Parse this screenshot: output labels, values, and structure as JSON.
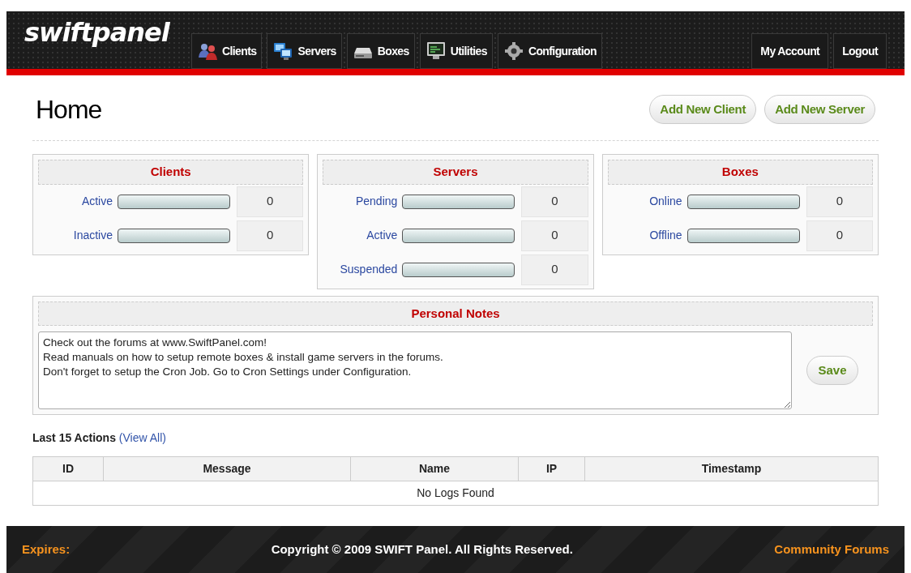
{
  "header": {
    "logo": "swiftpanel",
    "nav": [
      {
        "label": "Clients",
        "selected": false
      },
      {
        "label": "Servers",
        "selected": false
      },
      {
        "label": "Boxes",
        "selected": false
      },
      {
        "label": "Utilities",
        "selected": false
      },
      {
        "label": "Configuration",
        "selected": false
      }
    ],
    "account_nav": [
      "My Account",
      "Logout"
    ]
  },
  "page": {
    "title": "Home",
    "actions": [
      "Add New Client",
      "Add New Server"
    ]
  },
  "stats": [
    {
      "title": "Clients",
      "rows": [
        {
          "label": "Active",
          "level": 0,
          "count": "0"
        },
        {
          "label": "Inactive",
          "level": 0,
          "count": "0"
        }
      ]
    },
    {
      "title": "Servers",
      "rows": [
        {
          "label": "Pending",
          "level": 0,
          "count": "0"
        },
        {
          "label": "Active",
          "level": 0,
          "count": "0"
        },
        {
          "label": "Suspended",
          "level": 0,
          "count": "0"
        }
      ]
    },
    {
      "title": "Boxes",
      "rows": [
        {
          "label": "Online",
          "level": 0,
          "count": "0"
        },
        {
          "label": "Offline",
          "level": 0,
          "count": "0"
        }
      ]
    }
  ],
  "notes": {
    "title": "Personal Notes",
    "value": "Check out the forums at www.SwiftPanel.com!\nRead manuals on how to setup remote boxes & install game servers in the forums.\nDon't forget to setup the Cron Job. Go to Cron Settings under Configuration.",
    "button": "Save"
  },
  "actions": {
    "title": "Last 15 Actions",
    "link": "(View All)",
    "columns": [
      "ID",
      "Message",
      "Name",
      "IP",
      "Timestamp"
    ],
    "empty": "No Logs Found"
  },
  "footer": {
    "left": "Expires:",
    "center": "Copyright © 2009 SWIFT Panel. All Rights Reserved.",
    "right": "Community Forums"
  }
}
